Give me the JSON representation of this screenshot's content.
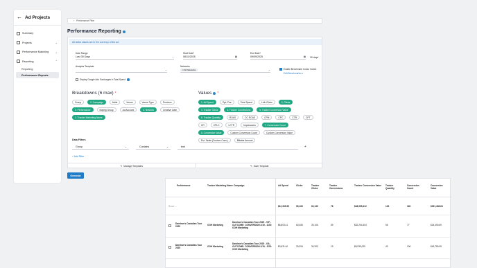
{
  "sidebar": {
    "title": "Ad Projects",
    "items": [
      {
        "label": "Summary",
        "icon": "summary-icon",
        "chevron": ""
      },
      {
        "label": "Projects",
        "icon": "projects-icon",
        "chevron": "⌄"
      },
      {
        "label": "Performance Matching",
        "icon": "matching-icon",
        "chevron": "⌄"
      },
      {
        "label": "Reporting",
        "icon": "reporting-icon",
        "chevron": "⌃"
      }
    ],
    "subitems": [
      {
        "label": "Reporting"
      },
      {
        "label": "Performance Reports"
      }
    ]
  },
  "filter_bar": {
    "label": "Performance Filter"
  },
  "page": {
    "title": "Performance Reporting"
  },
  "notice": "All dollar values are in the currency of the ad.",
  "form": {
    "date_range_label": "Date Range",
    "date_range_value": "Last 30 Days",
    "start_label": "Start Date*",
    "start_value": "08/11/2025",
    "end_label": "End Date*",
    "end_value": "09/09/2025",
    "days": "30 days",
    "template_label": "Analysis Template",
    "networks_label": "Networks",
    "networks_chip": "All Networks",
    "benchmark_label": "Enable Benchmark Colour Codes",
    "benchmark_link": "Edit Benchmarks",
    "google_label": "Display Google Ads Surcharges in Total Spend"
  },
  "breakdowns": {
    "title": "Breakdowns (6 max)",
    "chips": [
      {
        "label": "Group",
        "sel": false
      },
      {
        "label": "2. Campaign",
        "sel": true
      },
      {
        "label": "Artist",
        "sel": false
      },
      {
        "label": "Venue",
        "sel": false
      },
      {
        "label": "Venue Type",
        "sel": false
      },
      {
        "label": "Province",
        "sel": false
      },
      {
        "label": "3. Performance",
        "sel": true
      },
      {
        "label": "Buying Group",
        "sel": false
      },
      {
        "label": "Ad Account",
        "sel": false
      },
      {
        "label": "4. Network",
        "sel": true
      },
      {
        "label": "Creative Date",
        "sel": false
      },
      {
        "label": "1. Tracker Marketing Name",
        "sel": true
      }
    ]
  },
  "values": {
    "title": "Values",
    "chips": [
      {
        "label": "1. Ad Spend",
        "sel": true
      },
      {
        "label": "Opt. Fee",
        "sel": false
      },
      {
        "label": "Total Spend",
        "sel": false
      },
      {
        "label": "Link Clicks",
        "sel": false
      },
      {
        "label": "2. Clicks",
        "sel": true
      },
      {
        "label": "3. Tracker Clicks",
        "sel": true
      },
      {
        "label": "4. Tracker Conversions",
        "sel": true
      },
      {
        "label": "5. Tracker Conversion Value",
        "sel": true
      },
      {
        "label": "6. Tracker Quantity",
        "sel": true
      },
      {
        "label": "ROAS",
        "sel": false
      },
      {
        "label": "CC ROAS",
        "sel": false
      },
      {
        "label": "CPM",
        "sel": false
      },
      {
        "label": "CPC",
        "sel": false
      },
      {
        "label": "CTR",
        "sel": false
      },
      {
        "label": "CPT",
        "sel": false
      },
      {
        "label": "CR",
        "sel": false
      },
      {
        "label": "CPLC",
        "sel": false
      },
      {
        "label": "LCTR",
        "sel": false
      },
      {
        "label": "Impressions",
        "sel": false
      },
      {
        "label": "7. Conversion Count",
        "sel": true
      },
      {
        "label": "8. Conversion Value",
        "sel": true
      },
      {
        "label": "Custom Conversion Count",
        "sel": false
      },
      {
        "label": "Custom Conversion Value",
        "sel": false
      },
      {
        "label": "Est. Seats (Custom Conv.)",
        "sel": false
      },
      {
        "label": "Billable Amount",
        "sel": false
      }
    ]
  },
  "data_filters": {
    "title": "Data Filters",
    "field": "Group",
    "operator": "Contains",
    "value": "test",
    "add": "+ Add Filter"
  },
  "footer": {
    "manage": "Manage Templates",
    "save": "Save Template"
  },
  "generate": "Generate",
  "table": {
    "headers": [
      "Performance",
      "Tracker Marketing Name",
      "Campaign",
      "Ad Spend",
      "Clicks",
      "Tracker Clicks",
      "Tracker Conversions",
      "Tracker Conversion Value",
      "Tracker Quantity",
      "Conversion Count",
      "Conversion Value"
    ],
    "total": {
      "label": "Reset",
      "values": [
        "$10,395.95",
        "95,169",
        "60,139",
        "78",
        "$48,955,412",
        "132",
        "160",
        "$351,498.63"
      ]
    },
    "rows": [
      {
        "performance": "Darshan's Canadian Tour 2025",
        "tracker": "OOH Marketing",
        "campaign": "Darshan's Canadian Tour 2025 - VIP - OUTCOME: CONVERSION 2/19 - 2/28: OOH Marketing",
        "values": [
          "$6,803.41",
          "60,455",
          "30,106",
          "59",
          "$32,204,304",
          "55",
          "77",
          "$24,490.69"
        ]
      },
      {
        "performance": "Darshan's Canadian Tour 2025",
        "tracker": "OOH Marketing",
        "campaign": "Darshan's Canadian Tour 2025 - GA - OUTCOME: CONVERSION 2/19 - 2/28: OOH Marketing",
        "values": [
          "$3,631.40",
          "30,394",
          "30,303",
          "19",
          "$8,939,025",
          "43",
          "106",
          "$49,780.95"
        ]
      }
    ]
  }
}
